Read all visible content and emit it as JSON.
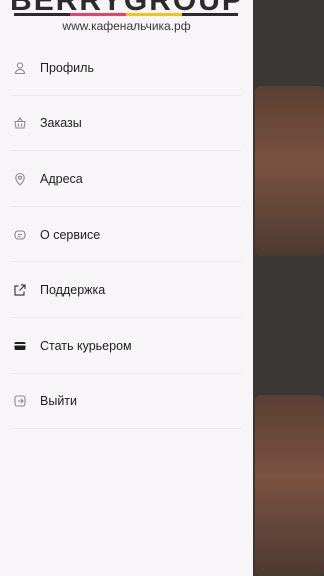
{
  "logo": {
    "text": "BERRYGROUP",
    "url": "www.кафенальчика.рф",
    "stripe_colors": [
      "#2d2a2b",
      "#e8416b",
      "#f4c21b",
      "#2d2a2b"
    ]
  },
  "menu": {
    "items": [
      {
        "label": "Профиль",
        "icon": "user-icon"
      },
      {
        "label": "Заказы",
        "icon": "basket-icon"
      },
      {
        "label": "Адреса",
        "icon": "location-pin-icon"
      },
      {
        "label": "О сервисе",
        "icon": "service-info-icon"
      },
      {
        "label": "Поддержка",
        "icon": "share-support-icon"
      },
      {
        "label": "Стать курьером",
        "icon": "card-icon"
      },
      {
        "label": "Выйти",
        "icon": "logout-icon"
      }
    ]
  }
}
